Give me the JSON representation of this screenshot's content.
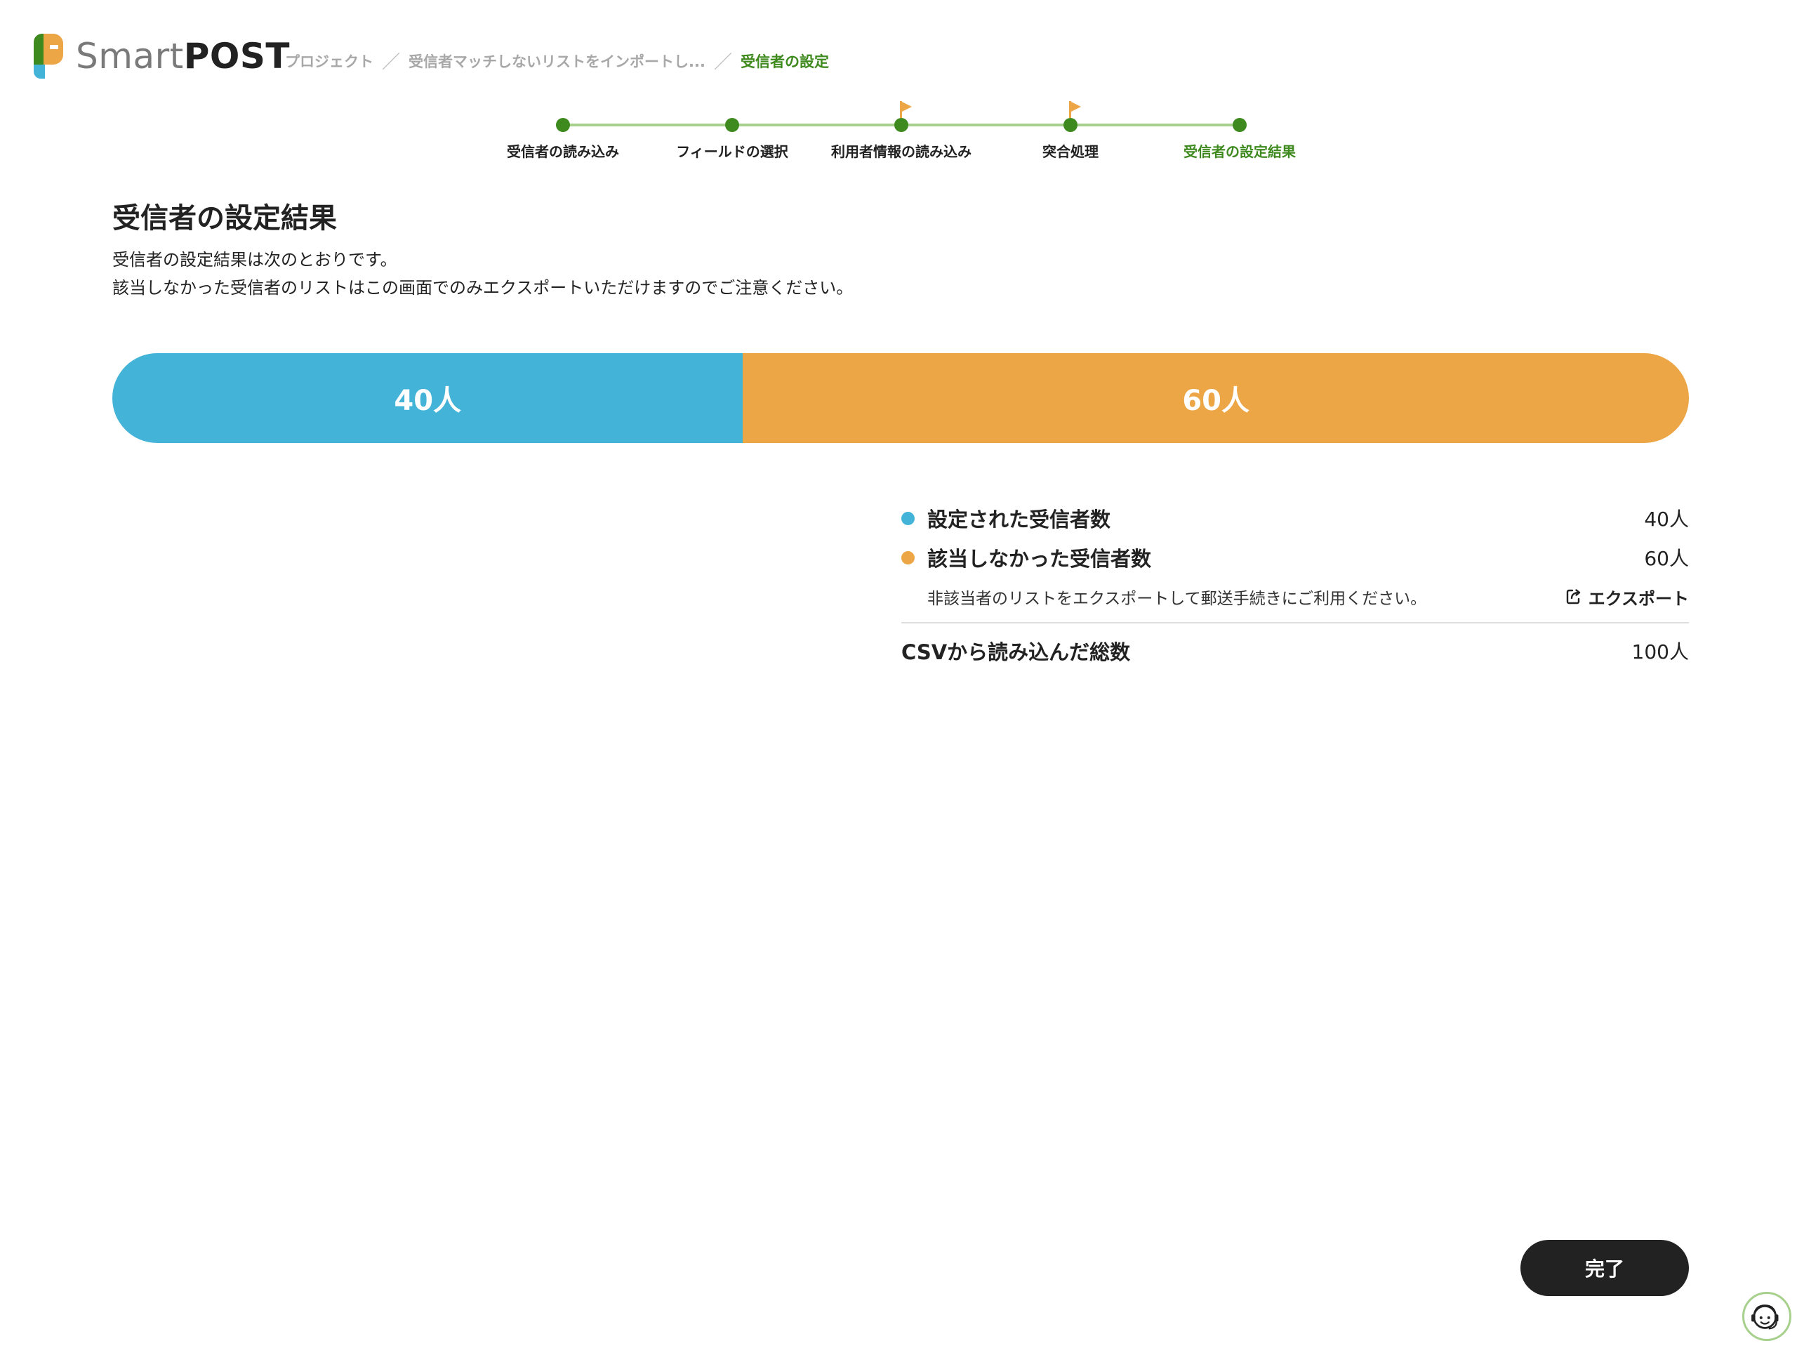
{
  "app": {
    "name_light": "Smart",
    "name_bold": "POST"
  },
  "breadcrumb": {
    "items": [
      "プロジェクト",
      "受信者マッチしないリストをインポートし...",
      "受信者の設定"
    ],
    "separator": "／"
  },
  "stepper": {
    "steps": [
      {
        "label": "受信者の読み込み",
        "flag": false,
        "active": false
      },
      {
        "label": "フィールドの選択",
        "flag": false,
        "active": false
      },
      {
        "label": "利用者情報の読み込み",
        "flag": true,
        "active": false
      },
      {
        "label": "突合処理",
        "flag": true,
        "active": false
      },
      {
        "label": "受信者の設定結果",
        "flag": false,
        "active": true
      }
    ]
  },
  "main": {
    "title": "受信者の設定結果",
    "description_line1": "受信者の設定結果は次のとおりです。",
    "description_line2": "該当しなかった受信者のリストはこの画面でのみエクスポートいただけますのでご注意ください。"
  },
  "bar": {
    "set_count": 40,
    "unmatched_count": 60,
    "set_label": "40人",
    "unmatched_label": "60人"
  },
  "summary": {
    "set_label": "設定された受信者数",
    "set_value": "40人",
    "unmatched_label": "該当しなかった受信者数",
    "unmatched_value": "60人",
    "note": "非該当者のリストをエクスポートして郵送手続きにご利用ください。",
    "export_label": "エクスポート",
    "total_label": "CSVから読み込んだ総数",
    "total_value": "100人"
  },
  "actions": {
    "done_label": "完了"
  },
  "colors": {
    "brand_green": "#3f8a1f",
    "set_blue": "#43b4d8",
    "unmatched_orange": "#eca646",
    "dark_button": "#222222"
  },
  "icons": {
    "export": "export-icon",
    "support": "support-icon",
    "flag": "flag-icon"
  }
}
